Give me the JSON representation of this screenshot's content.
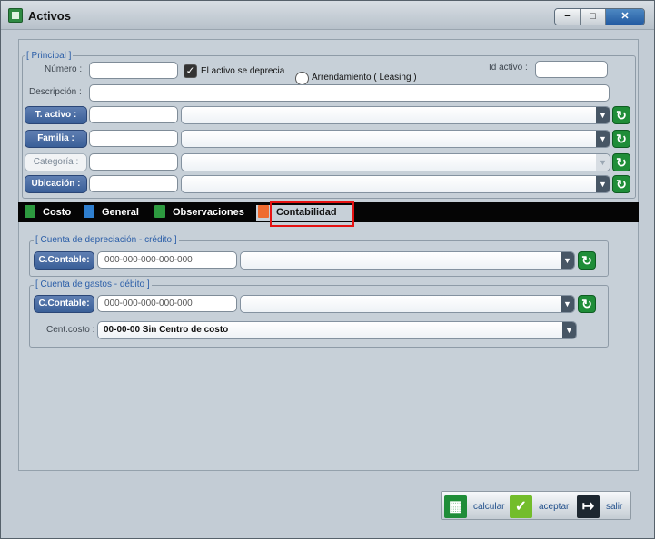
{
  "window": {
    "title": "Activos",
    "controls": {
      "minimize": "−",
      "maximize": "□",
      "close": "✕"
    }
  },
  "principal": {
    "legend": "[ Principal ]",
    "numero_label": "Número :",
    "numero_value": "",
    "se_deprecia_label": "El activo se deprecia",
    "se_deprecia_checked": true,
    "arrendamiento_label": "Arrendamiento ( Leasing )",
    "arrendamiento_checked": false,
    "id_activo_label": "Id activo :",
    "id_activo_value": "",
    "descripcion_label": "Descripción :",
    "descripcion_value": "",
    "rows": [
      {
        "label": "T. activo :",
        "code": "",
        "value": "",
        "disabled": false
      },
      {
        "label": "Familia :",
        "code": "",
        "value": "",
        "disabled": false
      },
      {
        "label": "Categoría :",
        "code": "",
        "value": "",
        "disabled": true
      },
      {
        "label": "Ubicación :",
        "code": "",
        "value": "",
        "disabled": false
      }
    ]
  },
  "tabs": [
    {
      "label": "Costo",
      "icon": "calculator-icon",
      "active": false
    },
    {
      "label": "General",
      "icon": "clipboard-icon",
      "active": false
    },
    {
      "label": "Observaciones",
      "icon": "checklist-icon",
      "active": false
    },
    {
      "label": "Contabilidad",
      "icon": "house-icon",
      "active": true
    }
  ],
  "contabilidad": {
    "credito": {
      "legend": "[ Cuenta de depreciación - crédito ]",
      "button": "C.Contable:",
      "placeholder": "000-000-000-000-000",
      "value": ""
    },
    "debito": {
      "legend": "[ Cuenta de gastos - débito ]",
      "button": "C.Contable:",
      "placeholder": "000-000-000-000-000",
      "value": ""
    },
    "cent_costo_label": "Cent.costo :",
    "cent_costo_value": "00-00-00 Sin Centro de costo"
  },
  "footer": {
    "calcular": "calcular",
    "aceptar": "aceptar",
    "salir": "salir"
  },
  "colors": {
    "window_bg": "#c3ccd5",
    "accent_blue": "#3a5f98",
    "refresh_green": "#1f8d38",
    "tab_highlight": "#e51212"
  }
}
